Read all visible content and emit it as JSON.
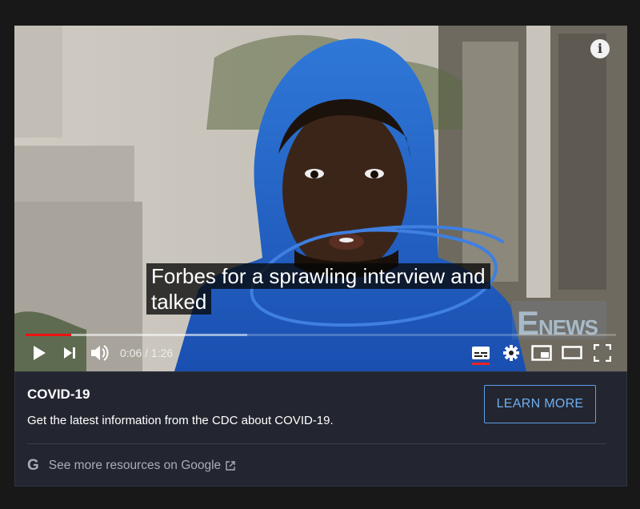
{
  "video": {
    "captions": [
      "Forbes for a sprawling interview and",
      "talked"
    ],
    "watermark": {
      "big": "E",
      "small": "NEWS"
    },
    "progress": {
      "played_fraction": 0.077,
      "buffered_fraction": 0.375
    },
    "time_current": "0:06",
    "time_separator": " / ",
    "time_total": "1:26",
    "icons": [
      "info-icon",
      "play-icon",
      "next-icon",
      "volume-icon",
      "subtitles-icon",
      "settings-gear-icon",
      "miniplayer-icon",
      "theater-mode-icon",
      "fullscreen-icon"
    ],
    "accent_color": "#e11"
  },
  "info_panel": {
    "title": "COVID-19",
    "description": "Get the latest information from the CDC about COVID-19.",
    "button_label": "LEARN MORE",
    "resources_logo": "G",
    "resources_label": "See more resources on Google",
    "button_color": "#5ea0e8"
  }
}
